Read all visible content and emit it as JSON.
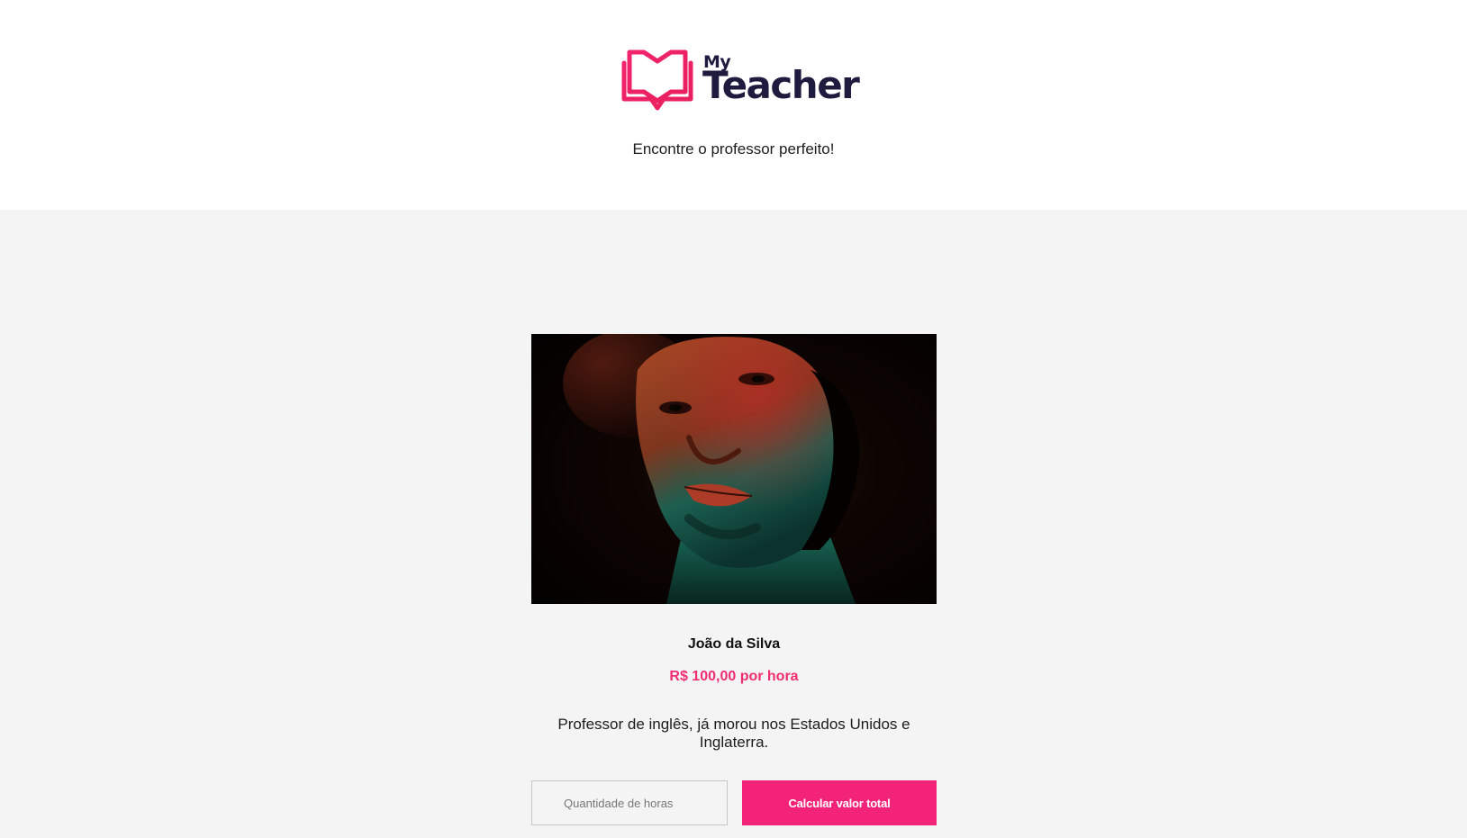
{
  "header": {
    "logo_small": "My",
    "logo_large": "Teacher",
    "tagline": "Encontre o professor perfeito!"
  },
  "teacher": {
    "name": "João da Silva",
    "price": "R$ 100,00 por hora",
    "description": "Professor de inglês, já morou nos Estados Unidos e Inglaterra."
  },
  "form": {
    "hours_placeholder": "Quantidade de horas",
    "hours_value": "",
    "submit_label": "Calcular valor total"
  },
  "colors": {
    "accent": "#f4237a",
    "logo_text": "#1e1b3f",
    "background": "#f4f4f4"
  }
}
